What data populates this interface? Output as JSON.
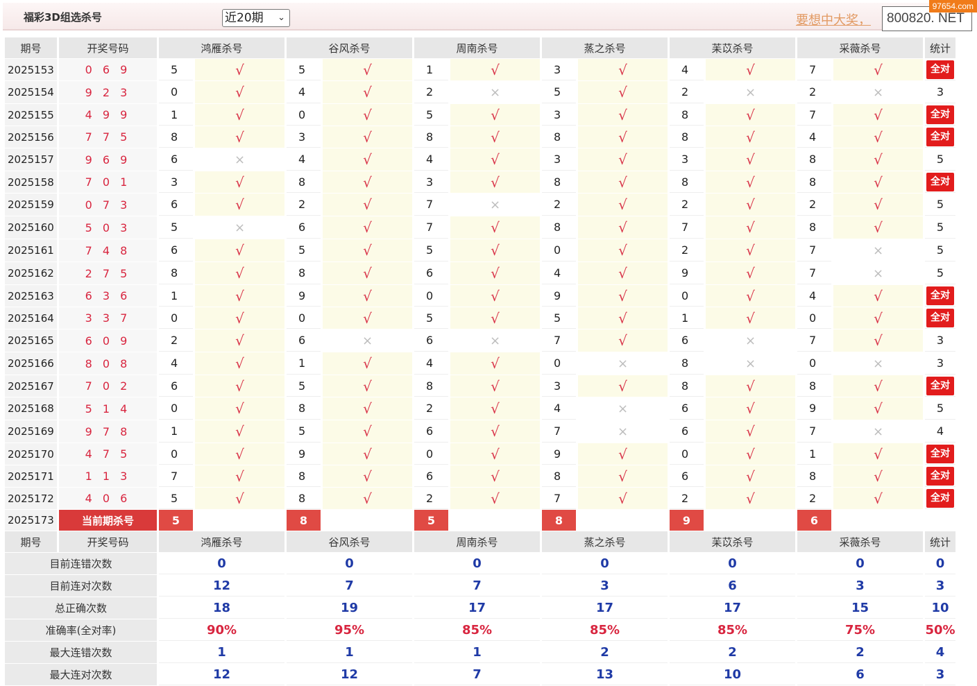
{
  "header": {
    "title": "福彩3D组选杀号",
    "period_select": "近20期",
    "promo_text": "要想中大奖，",
    "promo_site": "800820. NET",
    "watermark": "97654.com"
  },
  "columns": {
    "issue": "期号",
    "draw": "开奖号码",
    "experts": [
      "鸿雁杀号",
      "谷风杀号",
      "周南杀号",
      "蒸之杀号",
      "苿苡杀号",
      "采薇杀号"
    ],
    "stat": "统计"
  },
  "rows": [
    {
      "issue": "2025153",
      "draw": "0 6 9",
      "kills": [
        "5",
        "5",
        "1",
        "3",
        "4",
        "7"
      ],
      "marks": [
        "ok",
        "ok",
        "ok",
        "ok",
        "ok",
        "ok"
      ],
      "stat": "全对"
    },
    {
      "issue": "2025154",
      "draw": "9 2 3",
      "kills": [
        "0",
        "4",
        "2",
        "5",
        "2",
        "2"
      ],
      "marks": [
        "ok",
        "ok",
        "no",
        "ok",
        "no",
        "no"
      ],
      "stat": "3"
    },
    {
      "issue": "2025155",
      "draw": "4 9 9",
      "kills": [
        "1",
        "0",
        "5",
        "3",
        "8",
        "7"
      ],
      "marks": [
        "ok",
        "ok",
        "ok",
        "ok",
        "ok",
        "ok"
      ],
      "stat": "全对"
    },
    {
      "issue": "2025156",
      "draw": "7 7 5",
      "kills": [
        "8",
        "3",
        "8",
        "8",
        "8",
        "4"
      ],
      "marks": [
        "ok",
        "ok",
        "ok",
        "ok",
        "ok",
        "ok"
      ],
      "stat": "全对"
    },
    {
      "issue": "2025157",
      "draw": "9 6 9",
      "kills": [
        "6",
        "4",
        "4",
        "3",
        "3",
        "8"
      ],
      "marks": [
        "no",
        "ok",
        "ok",
        "ok",
        "ok",
        "ok"
      ],
      "stat": "5"
    },
    {
      "issue": "2025158",
      "draw": "7 0 1",
      "kills": [
        "3",
        "8",
        "3",
        "8",
        "8",
        "8"
      ],
      "marks": [
        "ok",
        "ok",
        "ok",
        "ok",
        "ok",
        "ok"
      ],
      "stat": "全对"
    },
    {
      "issue": "2025159",
      "draw": "0 7 3",
      "kills": [
        "6",
        "2",
        "7",
        "2",
        "2",
        "2"
      ],
      "marks": [
        "ok",
        "ok",
        "no",
        "ok",
        "ok",
        "ok"
      ],
      "stat": "5"
    },
    {
      "issue": "2025160",
      "draw": "5 0 3",
      "kills": [
        "5",
        "6",
        "7",
        "8",
        "7",
        "8"
      ],
      "marks": [
        "no",
        "ok",
        "ok",
        "ok",
        "ok",
        "ok"
      ],
      "stat": "5"
    },
    {
      "issue": "2025161",
      "draw": "7 4 8",
      "kills": [
        "6",
        "5",
        "5",
        "0",
        "2",
        "7"
      ],
      "marks": [
        "ok",
        "ok",
        "ok",
        "ok",
        "ok",
        "no"
      ],
      "stat": "5"
    },
    {
      "issue": "2025162",
      "draw": "2 7 5",
      "kills": [
        "8",
        "8",
        "6",
        "4",
        "9",
        "7"
      ],
      "marks": [
        "ok",
        "ok",
        "ok",
        "ok",
        "ok",
        "no"
      ],
      "stat": "5"
    },
    {
      "issue": "2025163",
      "draw": "6 3 6",
      "kills": [
        "1",
        "9",
        "0",
        "9",
        "0",
        "4"
      ],
      "marks": [
        "ok",
        "ok",
        "ok",
        "ok",
        "ok",
        "ok"
      ],
      "stat": "全对"
    },
    {
      "issue": "2025164",
      "draw": "3 3 7",
      "kills": [
        "0",
        "0",
        "5",
        "5",
        "1",
        "0"
      ],
      "marks": [
        "ok",
        "ok",
        "ok",
        "ok",
        "ok",
        "ok"
      ],
      "stat": "全对"
    },
    {
      "issue": "2025165",
      "draw": "6 0 9",
      "kills": [
        "2",
        "6",
        "6",
        "7",
        "6",
        "7"
      ],
      "marks": [
        "ok",
        "no",
        "no",
        "ok",
        "no",
        "ok"
      ],
      "stat": "3"
    },
    {
      "issue": "2025166",
      "draw": "8 0 8",
      "kills": [
        "4",
        "1",
        "4",
        "0",
        "8",
        "0"
      ],
      "marks": [
        "ok",
        "ok",
        "ok",
        "no",
        "no",
        "no"
      ],
      "stat": "3"
    },
    {
      "issue": "2025167",
      "draw": "7 0 2",
      "kills": [
        "6",
        "5",
        "8",
        "3",
        "8",
        "8"
      ],
      "marks": [
        "ok",
        "ok",
        "ok",
        "ok",
        "ok",
        "ok"
      ],
      "stat": "全对"
    },
    {
      "issue": "2025168",
      "draw": "5 1 4",
      "kills": [
        "0",
        "8",
        "2",
        "4",
        "6",
        "9"
      ],
      "marks": [
        "ok",
        "ok",
        "ok",
        "no",
        "ok",
        "ok"
      ],
      "stat": "5"
    },
    {
      "issue": "2025169",
      "draw": "9 7 8",
      "kills": [
        "1",
        "5",
        "6",
        "7",
        "6",
        "7"
      ],
      "marks": [
        "ok",
        "ok",
        "ok",
        "no",
        "ok",
        "no"
      ],
      "stat": "4"
    },
    {
      "issue": "2025170",
      "draw": "4 7 5",
      "kills": [
        "0",
        "9",
        "0",
        "9",
        "0",
        "1"
      ],
      "marks": [
        "ok",
        "ok",
        "ok",
        "ok",
        "ok",
        "ok"
      ],
      "stat": "全对"
    },
    {
      "issue": "2025171",
      "draw": "1 1 3",
      "kills": [
        "7",
        "8",
        "6",
        "8",
        "6",
        "8"
      ],
      "marks": [
        "ok",
        "ok",
        "ok",
        "ok",
        "ok",
        "ok"
      ],
      "stat": "全对"
    },
    {
      "issue": "2025172",
      "draw": "4 0 6",
      "kills": [
        "5",
        "8",
        "2",
        "7",
        "2",
        "2"
      ],
      "marks": [
        "ok",
        "ok",
        "ok",
        "ok",
        "ok",
        "ok"
      ],
      "stat": "全对"
    }
  ],
  "current": {
    "issue": "2025173",
    "label": "当前期杀号",
    "kills": [
      "5",
      "8",
      "5",
      "8",
      "9",
      "6"
    ]
  },
  "summary": [
    {
      "label": "目前连错次数",
      "values": [
        "0",
        "0",
        "0",
        "0",
        "0",
        "0",
        "0"
      ]
    },
    {
      "label": "目前连对次数",
      "values": [
        "12",
        "7",
        "7",
        "3",
        "6",
        "3",
        "3"
      ]
    },
    {
      "label": "总正确次数",
      "values": [
        "18",
        "19",
        "17",
        "17",
        "17",
        "15",
        "10"
      ]
    },
    {
      "label": "准确率(全对率)",
      "values": [
        "90%",
        "95%",
        "85%",
        "85%",
        "85%",
        "75%",
        "50%"
      ],
      "rate": true
    },
    {
      "label": "最大连错次数",
      "values": [
        "1",
        "1",
        "1",
        "2",
        "2",
        "2",
        "4"
      ]
    },
    {
      "label": "最大连对次数",
      "values": [
        "12",
        "12",
        "7",
        "13",
        "10",
        "6",
        "3"
      ]
    }
  ],
  "colors": {
    "accent_red": "#d8253f",
    "badge_red": "#e21c1c",
    "value_blue": "#1f3aa6"
  }
}
